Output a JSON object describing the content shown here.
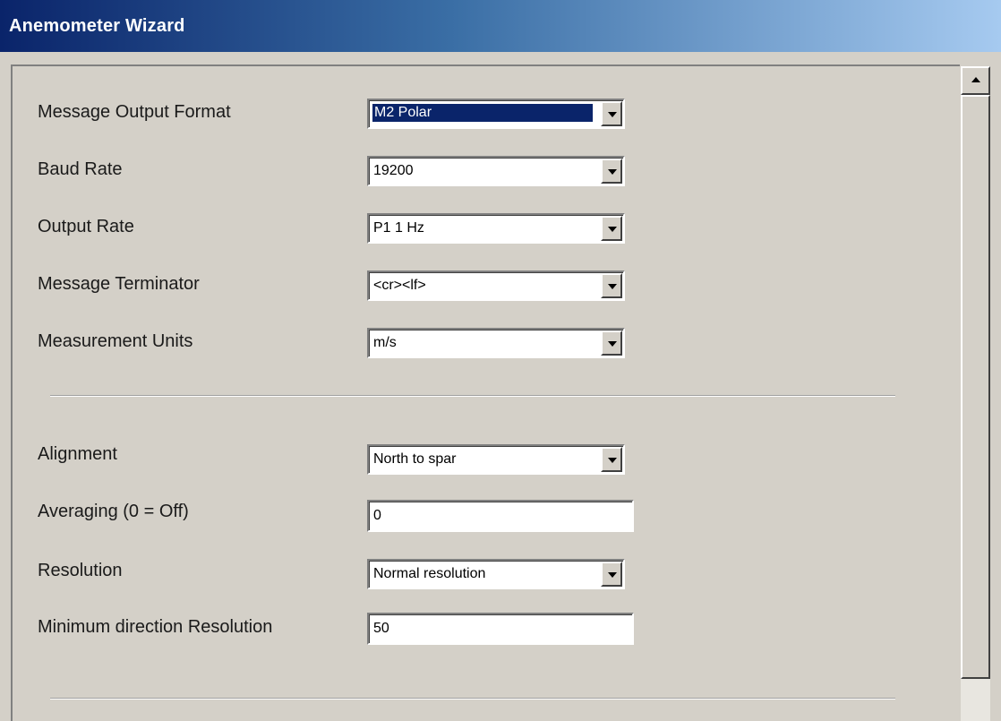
{
  "window": {
    "title": "Anemometer Wizard"
  },
  "fields": {
    "message_output_format": {
      "label": "Message Output Format",
      "value": "M2 Polar"
    },
    "baud_rate": {
      "label": "Baud Rate",
      "value": "19200"
    },
    "output_rate": {
      "label": "Output Rate",
      "value": "P1 1 Hz"
    },
    "message_terminator": {
      "label": "Message Terminator",
      "value": "<cr><lf>"
    },
    "measurement_units": {
      "label": "Measurement Units",
      "value": "m/s"
    },
    "alignment": {
      "label": "Alignment",
      "value": "North to spar"
    },
    "averaging": {
      "label": "Averaging (0 = Off)",
      "value": "0"
    },
    "resolution": {
      "label": "Resolution",
      "value": "Normal resolution"
    },
    "min_direction_resolution": {
      "label": "Minimum direction Resolution",
      "value": "50"
    }
  },
  "icons": {
    "dropdown": "chevron-down-icon",
    "scroll_up": "arrow-up-icon"
  },
  "colors": {
    "title_start": "#0a246a",
    "title_end": "#a6caf0",
    "face": "#d4d0c8",
    "selection": "#0a246a"
  }
}
